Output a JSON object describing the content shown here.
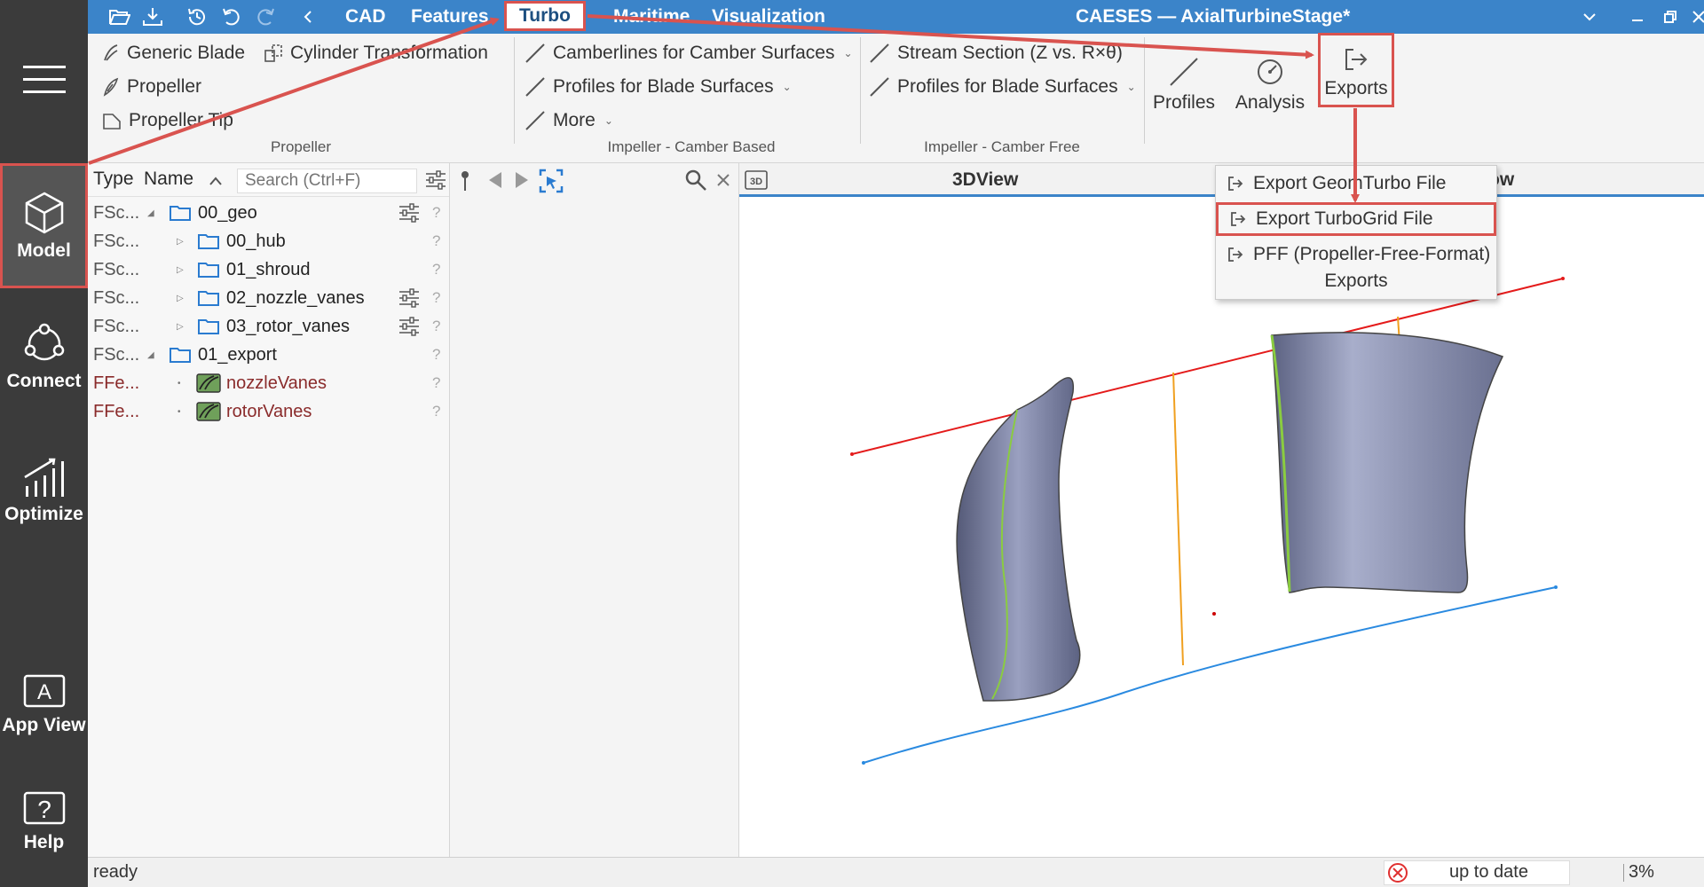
{
  "app": {
    "title": "CAESES — AxialTurbineStage*"
  },
  "sidebar": {
    "items": [
      {
        "label": "Model"
      },
      {
        "label": "Connect"
      },
      {
        "label": "Optimize"
      },
      {
        "label": "App View"
      },
      {
        "label": "Help"
      }
    ]
  },
  "titlebar": {
    "tabs": [
      "CAD",
      "Features",
      "Turbo",
      "Maritime",
      "Visualization"
    ]
  },
  "ribbon": {
    "propeller": {
      "items": [
        "Generic Blade",
        "Cylinder Transformation",
        "Propeller",
        "Propeller Tip"
      ],
      "group": "Propeller"
    },
    "camber_based": {
      "items": [
        "Camberlines for Camber Surfaces",
        "Profiles for Blade Surfaces",
        "More"
      ],
      "group": "Impeller - Camber Based"
    },
    "camber_free": {
      "items": [
        "Stream Section (Z vs. R×θ)",
        "Profiles for Blade Surfaces"
      ],
      "group": "Impeller - Camber Free"
    },
    "tools": {
      "profiles": "Profiles",
      "analysis": "Analysis",
      "exports": "Exports"
    }
  },
  "tree": {
    "headers": {
      "type": "Type",
      "name": "Name"
    },
    "search_placeholder": "Search (Ctrl+F)",
    "rows": [
      {
        "type": "FSc...",
        "name": "00_geo"
      },
      {
        "type": "FSc...",
        "name": "00_hub"
      },
      {
        "type": "FSc...",
        "name": "01_shroud"
      },
      {
        "type": "FSc...",
        "name": "02_nozzle_vanes"
      },
      {
        "type": "FSc...",
        "name": "03_rotor_vanes"
      },
      {
        "type": "FSc...",
        "name": "01_export"
      },
      {
        "type": "FFe...",
        "name": "nozzleVanes"
      },
      {
        "type": "FFe...",
        "name": "rotorVanes"
      }
    ],
    "help_mark": "?"
  },
  "view": {
    "title": "3DView",
    "title_2": "ow"
  },
  "dropdown": {
    "items": [
      "Export GeomTurbo File",
      "Export TurboGrid File",
      "PFF (Propeller-Free-Format)"
    ],
    "footer": "Exports"
  },
  "status": {
    "text": "ready",
    "sync": "up to date",
    "zoom": "3%"
  },
  "colors": {
    "titlebar": "#3b84c9",
    "sidebar": "#3b3b3b",
    "annotation": "#d9534f",
    "line_red": "#e41b1b",
    "line_blue": "#2a8ae0",
    "line_orange": "#f0a020",
    "blade": "#7c82a0"
  }
}
